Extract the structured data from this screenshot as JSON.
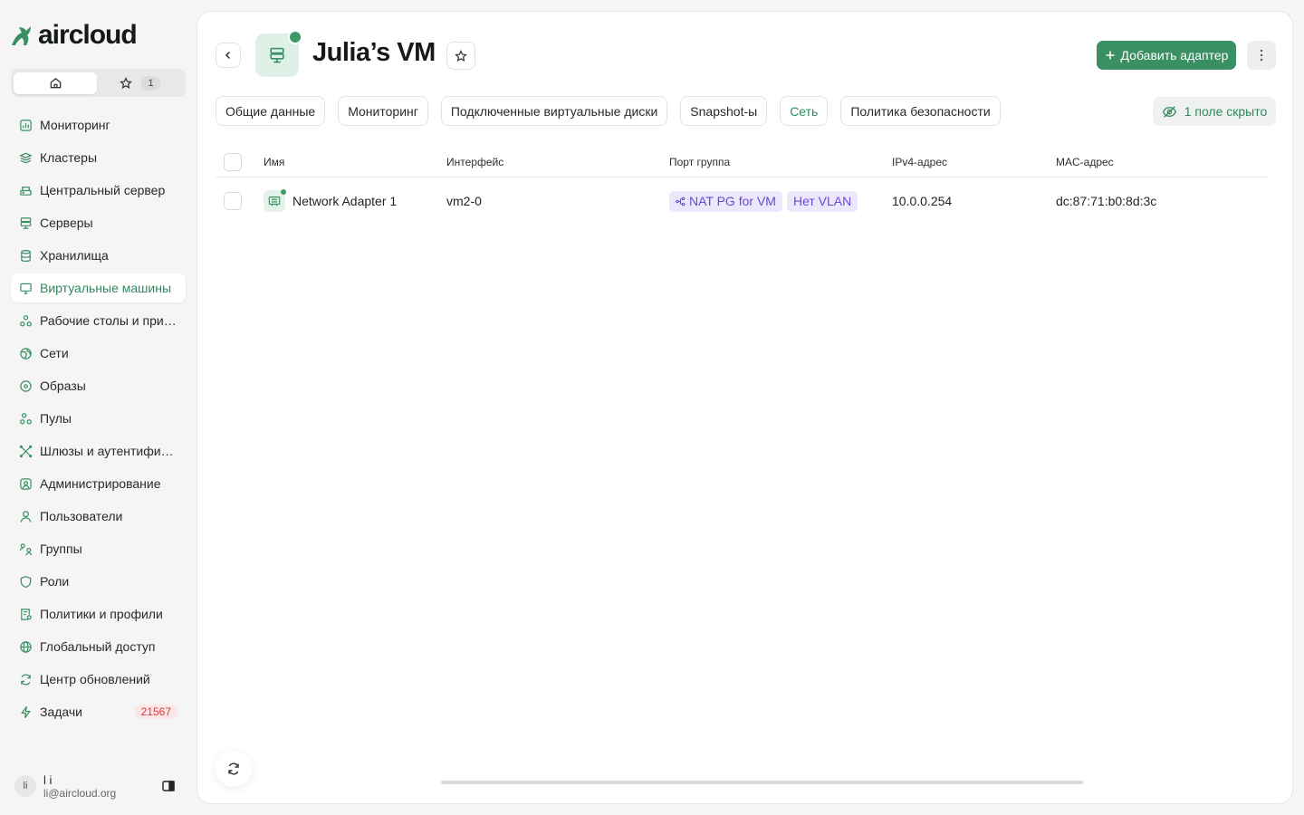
{
  "app": {
    "logo_text": "aircloud"
  },
  "favorites": {
    "count": "1"
  },
  "sidebar": {
    "items": [
      {
        "label": "Мониторинг",
        "icon": "chart-icon"
      },
      {
        "label": "Кластеры",
        "icon": "layers-icon"
      },
      {
        "label": "Центральный сервер",
        "icon": "central-server-icon"
      },
      {
        "label": "Серверы",
        "icon": "server-icon"
      },
      {
        "label": "Хранилища",
        "icon": "database-icon"
      },
      {
        "label": "Виртуальные машины",
        "icon": "monitor-icon",
        "active": true
      },
      {
        "label": "Рабочие столы и прил...",
        "icon": "apps-icon"
      },
      {
        "label": "Сети",
        "icon": "globe-net-icon"
      },
      {
        "label": "Образы",
        "icon": "disc-icon"
      },
      {
        "label": "Пулы",
        "icon": "pools-icon"
      },
      {
        "label": "Шлюзы и аутентифика...",
        "icon": "gateway-icon"
      },
      {
        "label": "Администрирование",
        "icon": "admin-icon"
      },
      {
        "label": "Пользователи",
        "icon": "user-icon"
      },
      {
        "label": "Группы",
        "icon": "group-icon"
      },
      {
        "label": "Роли",
        "icon": "shield-icon"
      },
      {
        "label": "Политики и профили",
        "icon": "policy-icon"
      },
      {
        "label": "Глобальный доступ",
        "icon": "globe-icon"
      },
      {
        "label": "Центр обновлений",
        "icon": "refresh-icon"
      },
      {
        "label": "Задачи",
        "icon": "bolt-icon",
        "badge": "21567"
      }
    ],
    "user": {
      "initials": "li",
      "name": "l i",
      "email": "li@aircloud.org"
    }
  },
  "header": {
    "title": "Julia’s VM",
    "add_button": "Добавить адаптер"
  },
  "tabs": [
    {
      "label": "Общие данные"
    },
    {
      "label": "Мониторинг"
    },
    {
      "label": "Подключенные виртуальные диски"
    },
    {
      "label": "Snapshot-ы"
    },
    {
      "label": "Сеть",
      "active": true
    },
    {
      "label": "Политика безопасности"
    }
  ],
  "hidden_fields": "1 поле скрыто",
  "table": {
    "columns": [
      "Имя",
      "Интерфейс",
      "Порт группа",
      "IPv4-адрес",
      "MAC-адрес"
    ],
    "rows": [
      {
        "name": "Network Adapter 1",
        "interface": "vm2-0",
        "port_group": "NAT PG for VM",
        "vlan": "Нет VLAN",
        "ipv4": "10.0.0.254",
        "mac": "dc:87:71:b0:8d:3c"
      }
    ]
  },
  "colors": {
    "accent": "#3a8f63",
    "badge_red": "#d63b3b",
    "pill_purple": "#6b49d6"
  }
}
